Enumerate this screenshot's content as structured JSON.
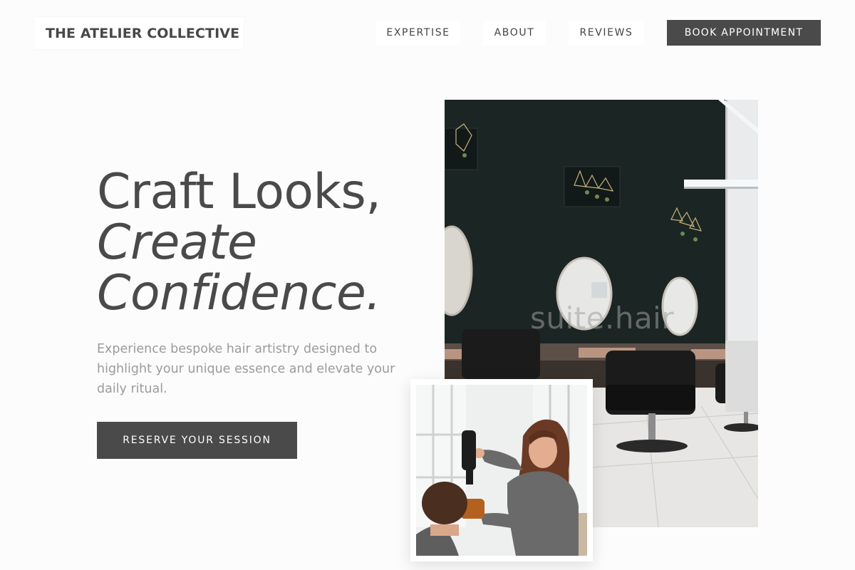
{
  "header": {
    "brand": "THE ATELIER COLLECTIVE",
    "nav": [
      {
        "label": "EXPERTISE"
      },
      {
        "label": "ABOUT"
      },
      {
        "label": "REVIEWS"
      }
    ],
    "cta_label": "BOOK APPOINTMENT"
  },
  "hero": {
    "title_line1": "Craft Looks,",
    "title_line2": "Create",
    "title_line3": "Confidence.",
    "description": "Experience bespoke hair artistry designed to highlight your unique essence and elevate your daily ritual.",
    "cta_label": "RESERVE YOUR SESSION"
  },
  "images": {
    "salon_watermark": "suite.hair"
  },
  "colors": {
    "primary_dark": "#4a4a4a",
    "background": "#fcfcfc",
    "muted_text": "#9b9b9b"
  }
}
